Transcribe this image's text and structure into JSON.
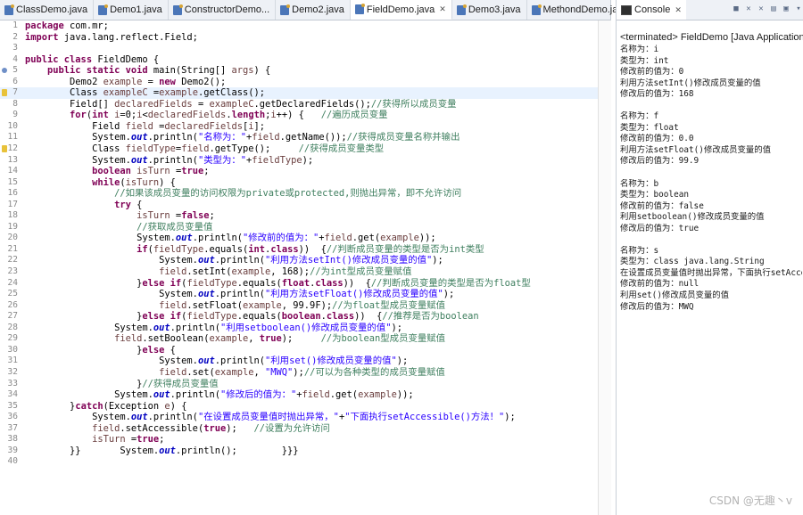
{
  "editor": {
    "tabs": [
      {
        "label": "ClassDemo.java",
        "active": false
      },
      {
        "label": "Demo1.java",
        "active": false
      },
      {
        "label": "ConstructorDemo...",
        "active": false
      },
      {
        "label": "Demo2.java",
        "active": false
      },
      {
        "label": "FieldDemo.java",
        "active": true
      },
      {
        "label": "Demo3.java",
        "active": false
      },
      {
        "label": "MethondDemo.java",
        "active": false
      }
    ],
    "close_glyph": "✕"
  },
  "code": {
    "lines": [
      {
        "n": "1",
        "h": "<span class='kw'>package</span> com.mr;"
      },
      {
        "n": "2",
        "h": "<span class='kw'>import</span> java.lang.reflect.Field;"
      },
      {
        "n": "3",
        "h": ""
      },
      {
        "n": "4",
        "h": "<span class='kw'>public class</span> FieldDemo {"
      },
      {
        "n": "5",
        "h": "    <span class='kw'>public static void</span> main(String[] <span class='var'>args</span>) {",
        "ann": "bp"
      },
      {
        "n": "6",
        "h": "        Demo2 <span class='var'>example</span> = <span class='kw'>new</span> Demo2();"
      },
      {
        "n": "7",
        "h": "        Class <span class='var'>exampleC</span> =<span class='var'>example</span>.getClass();",
        "hl": true,
        "ann": "warn"
      },
      {
        "n": "8",
        "h": "        Field[] <span class='var'>declaredFields</span> = <span class='var'>exampleC</span>.getDeclaredFields();<span class='cmt'>//获得所以成员变量</span>"
      },
      {
        "n": "9",
        "h": "        <span class='kw'>for</span>(<span class='kw'>int</span> <span class='var'>i</span>=0;<span class='var'>i</span>&lt;<span class='var'>declaredFields</span>.<span class='kw'>length</span>;<span class='var'>i</span>++) {   <span class='cmt'>//遍历成员变量</span>"
      },
      {
        "n": "10",
        "h": "            Field <span class='var'>field</span> =<span class='var'>declaredFields</span>[<span class='var'>i</span>];"
      },
      {
        "n": "11",
        "h": "            System.<span class='fld'>out</span>.println(<span class='str'>\"名称为：\"</span>+<span class='var'>field</span>.getName());<span class='cmt'>//获得成员变量名称并输出</span>"
      },
      {
        "n": "12",
        "h": "            Class <span class='var'>fieldType</span>=<span class='var'>field</span>.getType();     <span class='cmt'>//获得成员变量类型</span>",
        "ann": "warn"
      },
      {
        "n": "13",
        "h": "            System.<span class='fld'>out</span>.println(<span class='str'>\"类型为：\"</span>+<span class='var'>fieldType</span>);"
      },
      {
        "n": "14",
        "h": "            <span class='kw'>boolean</span> <span class='var'>isTurn</span> =<span class='kw'>true</span>;"
      },
      {
        "n": "15",
        "h": "            <span class='kw'>while</span>(<span class='var'>isTurn</span>) {"
      },
      {
        "n": "16",
        "h": "                <span class='cmt'>//如果该成员变量的访问权限为private或protected,则抛出异常，即不允许访问</span>"
      },
      {
        "n": "17",
        "h": "                <span class='kw'>try</span> {"
      },
      {
        "n": "18",
        "h": "                    <span class='var'>isTurn</span> =<span class='kw'>false</span>;"
      },
      {
        "n": "19",
        "h": "                    <span class='cmt'>//获取成员变量值</span>"
      },
      {
        "n": "20",
        "h": "                    System.<span class='fld'>out</span>.println(<span class='str'>\"修改前的值为：\"</span>+<span class='var'>field</span>.get(<span class='var'>example</span>));"
      },
      {
        "n": "21",
        "h": "                    <span class='kw'>if</span>(<span class='var'>fieldType</span>.equals(<span class='kw'>int</span>.<span class='kw'>class</span>))  {<span class='cmt'>//判断成员变量的类型是否为int类型</span>"
      },
      {
        "n": "22",
        "h": "                        System.<span class='fld'>out</span>.println(<span class='str'>\"利用方法setInt()修改成员变量的值\"</span>);"
      },
      {
        "n": "23",
        "h": "                        <span class='var'>field</span>.setInt(<span class='var'>example</span>, 168);<span class='cmt'>//为int型成员变量赋值</span>"
      },
      {
        "n": "24",
        "h": "                    }<span class='kw'>else if</span>(<span class='var'>fieldType</span>.equals(<span class='kw'>float</span>.<span class='kw'>class</span>))  {<span class='cmt'>//判断成员变量的类型是否为float型</span>"
      },
      {
        "n": "25",
        "h": "                        System.<span class='fld'>out</span>.println(<span class='str'>\"利用方法setFloat()修改成员变量的值\"</span>);"
      },
      {
        "n": "26",
        "h": "                        <span class='var'>field</span>.setFloat(<span class='var'>example</span>, 99.9F);<span class='cmt'>//为float型成员变量赋值</span>"
      },
      {
        "n": "27",
        "h": "                    }<span class='kw'>else if</span>(<span class='var'>fieldType</span>.equals(<span class='kw'>boolean</span>.<span class='kw'>class</span>))  {<span class='cmt'>//推荐是否为boolean</span>"
      },
      {
        "n": "28",
        "h": "                System.<span class='fld'>out</span>.println(<span class='str'>\"利用setboolean()修改成员变量的值\"</span>);"
      },
      {
        "n": "29",
        "h": "                <span class='var'>field</span>.setBoolean(<span class='var'>example</span>, <span class='kw'>true</span>);     <span class='cmt'>//为boolean型成员变量赋值</span>"
      },
      {
        "n": "30",
        "h": "                    }<span class='kw'>else</span> {"
      },
      {
        "n": "31",
        "h": "                        System.<span class='fld'>out</span>.println(<span class='str'>\"利用set()修改成员变量的值\"</span>);"
      },
      {
        "n": "32",
        "h": "                        <span class='var'>field</span>.set(<span class='var'>example</span>, <span class='str'>\"MWQ\"</span>);<span class='cmt'>//可以为各种类型的成员变量赋值</span>"
      },
      {
        "n": "33",
        "h": "                    }<span class='cmt'>//获得成员变量值</span>"
      },
      {
        "n": "34",
        "h": "                System.<span class='fld'>out</span>.println(<span class='str'>\"修改后的值为：\"</span>+<span class='var'>field</span>.get(<span class='var'>example</span>));"
      },
      {
        "n": "35",
        "h": "        }<span class='kw'>catch</span>(Exception <span class='var'>e</span>) {"
      },
      {
        "n": "36",
        "h": "            System.<span class='fld'>out</span>.println(<span class='str'>\"在设置成员变量值时抛出异常，\"</span>+<span class='str'>\"下面执行setAccessible()方法！\"</span>);"
      },
      {
        "n": "37",
        "h": "            <span class='var'>field</span>.setAccessible(<span class='kw'>true</span>);   <span class='cmt'>//设置为允许访问</span>"
      },
      {
        "n": "38",
        "h": "            <span class='var'>isTurn</span> =<span class='kw'>true</span>;"
      },
      {
        "n": "39",
        "h": "        }}       System.<span class='fld'>out</span>.println();        }}}"
      },
      {
        "n": "40",
        "h": ""
      }
    ]
  },
  "console": {
    "tab_label": "Console",
    "close_glyph": "✕",
    "terminated": "<terminated> FieldDemo [Java Application]",
    "lines": [
      "名称为：i",
      "类型为：int",
      "修改前的值为：0",
      "利用方法setInt()修改成员变量的值",
      "修改后的值为：168",
      "",
      "名称为：f",
      "类型为：float",
      "修改前的值为：0.0",
      "利用方法setFloat()修改成员变量的值",
      "修改后的值为：99.9",
      "",
      "名称为：b",
      "类型为：boolean",
      "修改前的值为：false",
      "利用setboolean()修改成员变量的值",
      "修改后的值为：true",
      "",
      "名称为：s",
      "类型为：class java.lang.String",
      "在设置成员变量值时抛出异常，下面执行setAccessible()方法！",
      "修改前的值为：null",
      "利用set()修改成员变量的值",
      "修改后的值为：MWQ"
    ]
  },
  "watermark": {
    "main": "CSDN @无趣丶v",
    "sub": "CSDN @无趣丶v"
  }
}
